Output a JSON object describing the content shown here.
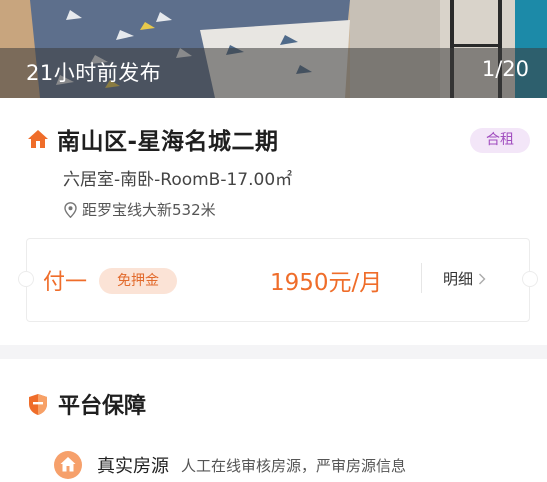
{
  "photo": {
    "posted": "21小时前发布",
    "counter": "1/20"
  },
  "listing": {
    "title": "南山区-星海名城二期",
    "tag": "合租",
    "subtitle": "六居室-南卧-RoomB-17.00㎡",
    "location": "距罗宝线大新532米"
  },
  "payment": {
    "type": "付一",
    "deposit": "免押金",
    "price": "1950元/月",
    "detail": "明细"
  },
  "guarantee": {
    "title": "平台保障",
    "items": [
      {
        "name": "真实房源",
        "desc": "人工在线审核房源，严审房源信息"
      }
    ]
  },
  "colors": {
    "accent": "#ef6d2a",
    "tag_bg": "#f3e6f8",
    "tag_text": "#a24fc0",
    "deposit_bg": "#fbe3d6"
  },
  "icons": {
    "title": "house-icon",
    "location": "pin-icon",
    "detail": "chevron-right-icon",
    "guarantee": "shield-icon",
    "item": "house-circle-icon"
  }
}
